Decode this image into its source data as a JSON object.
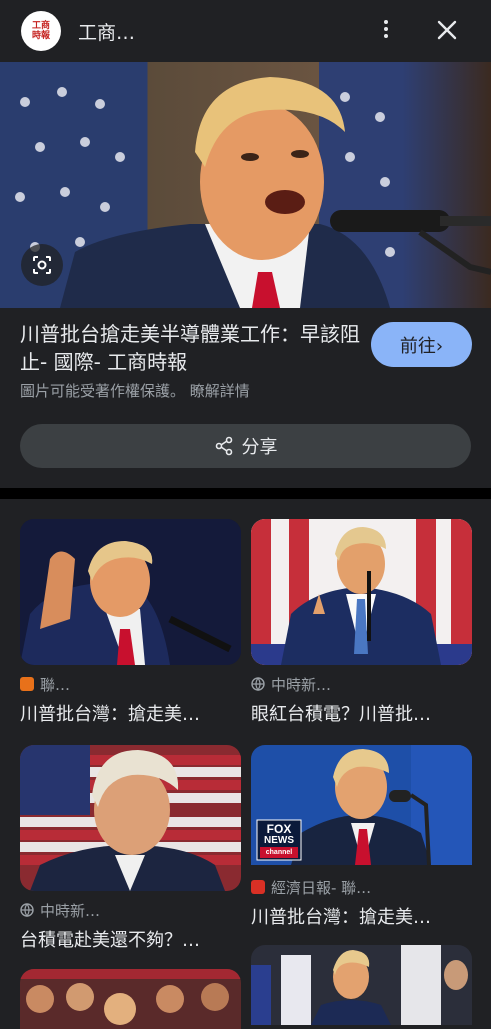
{
  "header": {
    "logo_text": "工商\n時報",
    "site_name": "工商…"
  },
  "hero": {
    "headline": "川普批台搶走美半導體業工作：早該阻止- 國際- 工商時報",
    "goto_label": "前往›",
    "copyright": "圖片可能受著作權保護。 瞭解詳情",
    "share_label": "分享"
  },
  "results": [
    {
      "source": "聯…",
      "title": "川普批台灣：搶走美…",
      "icon": "udn-icon",
      "fav_color": "#e8711a"
    },
    {
      "source": "中時新…",
      "title": "眼紅台積電？川普批…",
      "icon": "globe-icon"
    },
    {
      "source": "中時新…",
      "title": "台積電赴美還不夠？…",
      "icon": "globe-icon"
    },
    {
      "source": "經濟日報- 聯…",
      "title": "川普批台灣：搶走美…",
      "icon": "money-udn-icon",
      "fav_color": "#d93025"
    }
  ],
  "thumb_overlay": {
    "fox_line1": "FOX",
    "fox_line2": "NEWS",
    "fox_line3": "channel"
  }
}
